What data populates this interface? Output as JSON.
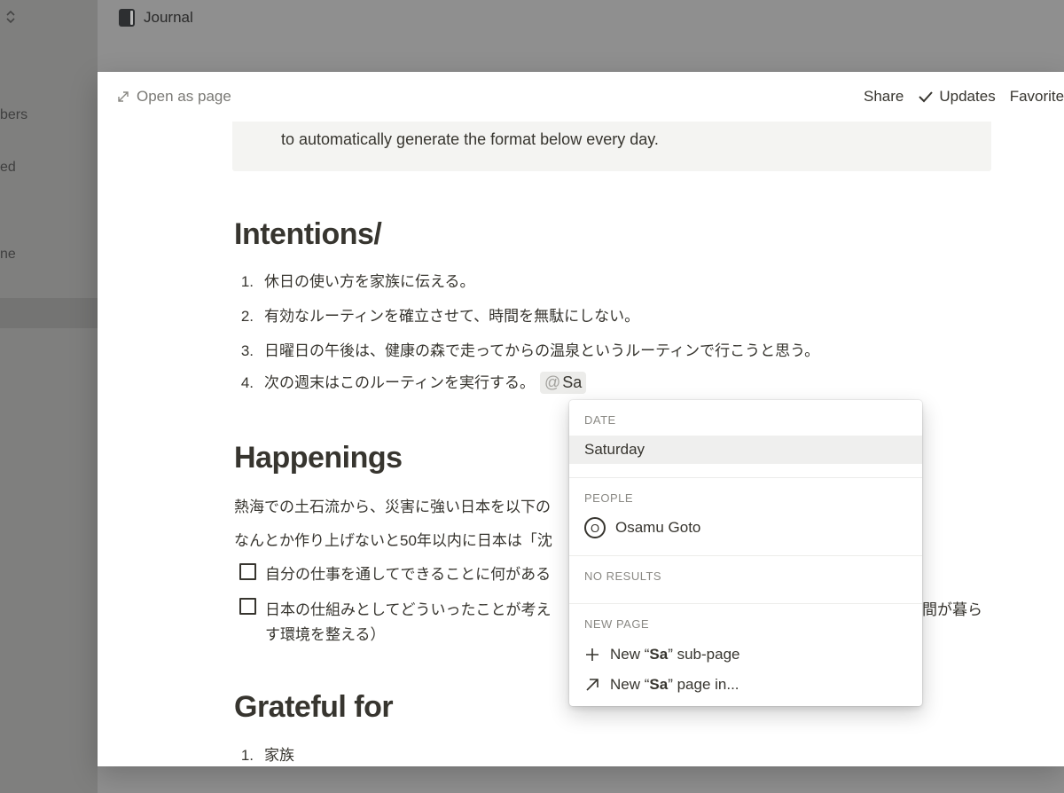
{
  "sidebar": {
    "items": [
      "bers",
      "ed",
      "ne"
    ]
  },
  "page": {
    "breadcrumb": "Journal"
  },
  "modal": {
    "open_as_page": "Open as page",
    "actions": {
      "share": "Share",
      "updates": "Updates",
      "favorite": "Favorite"
    },
    "callout_text": "to automatically generate the format below every day.",
    "intentions": {
      "heading": "Intentions/",
      "items": [
        {
          "num": "1.",
          "text": "休日の使い方を家族に伝える。"
        },
        {
          "num": "2.",
          "text": "有効なルーティンを確立させて、時間を無駄にしない。"
        },
        {
          "num": "3.",
          "text": "日曜日の午後は、健康の森で走ってからの温泉というルーティンで行こうと思う。"
        },
        {
          "num": "4.",
          "text": "次の週末はこのルーティンを実行する。"
        }
      ],
      "mention": {
        "symbol": "@",
        "query": "Sa"
      }
    },
    "happenings": {
      "heading": "Happenings",
      "para1": "熱海での土石流から、災害に強い日本を以下の",
      "para2": "なんとか作り上げないと50年以内に日本は「沈",
      "todo1": "自分の仕事を通してできることに何がある",
      "todo2_left": "日本の仕組みとしてどういったことが考え",
      "todo2_right": "間が暮ら",
      "todo2_line2": "す環境を整える）"
    },
    "grateful": {
      "heading": "Grateful for",
      "items": [
        {
          "num": "1.",
          "text": "家族"
        }
      ]
    }
  },
  "menu": {
    "date_title": "DATE",
    "date_item": "Saturday",
    "people_title": "PEOPLE",
    "person_initial": "O",
    "person_name": "Osamu Goto",
    "no_results": "NO RESULTS",
    "new_page_title": "NEW PAGE",
    "sub_page": {
      "pre": "New “",
      "bold": "Sa",
      "post": "” sub-page"
    },
    "page_in": {
      "pre": "New “",
      "bold": "Sa",
      "post": "” page in..."
    }
  }
}
